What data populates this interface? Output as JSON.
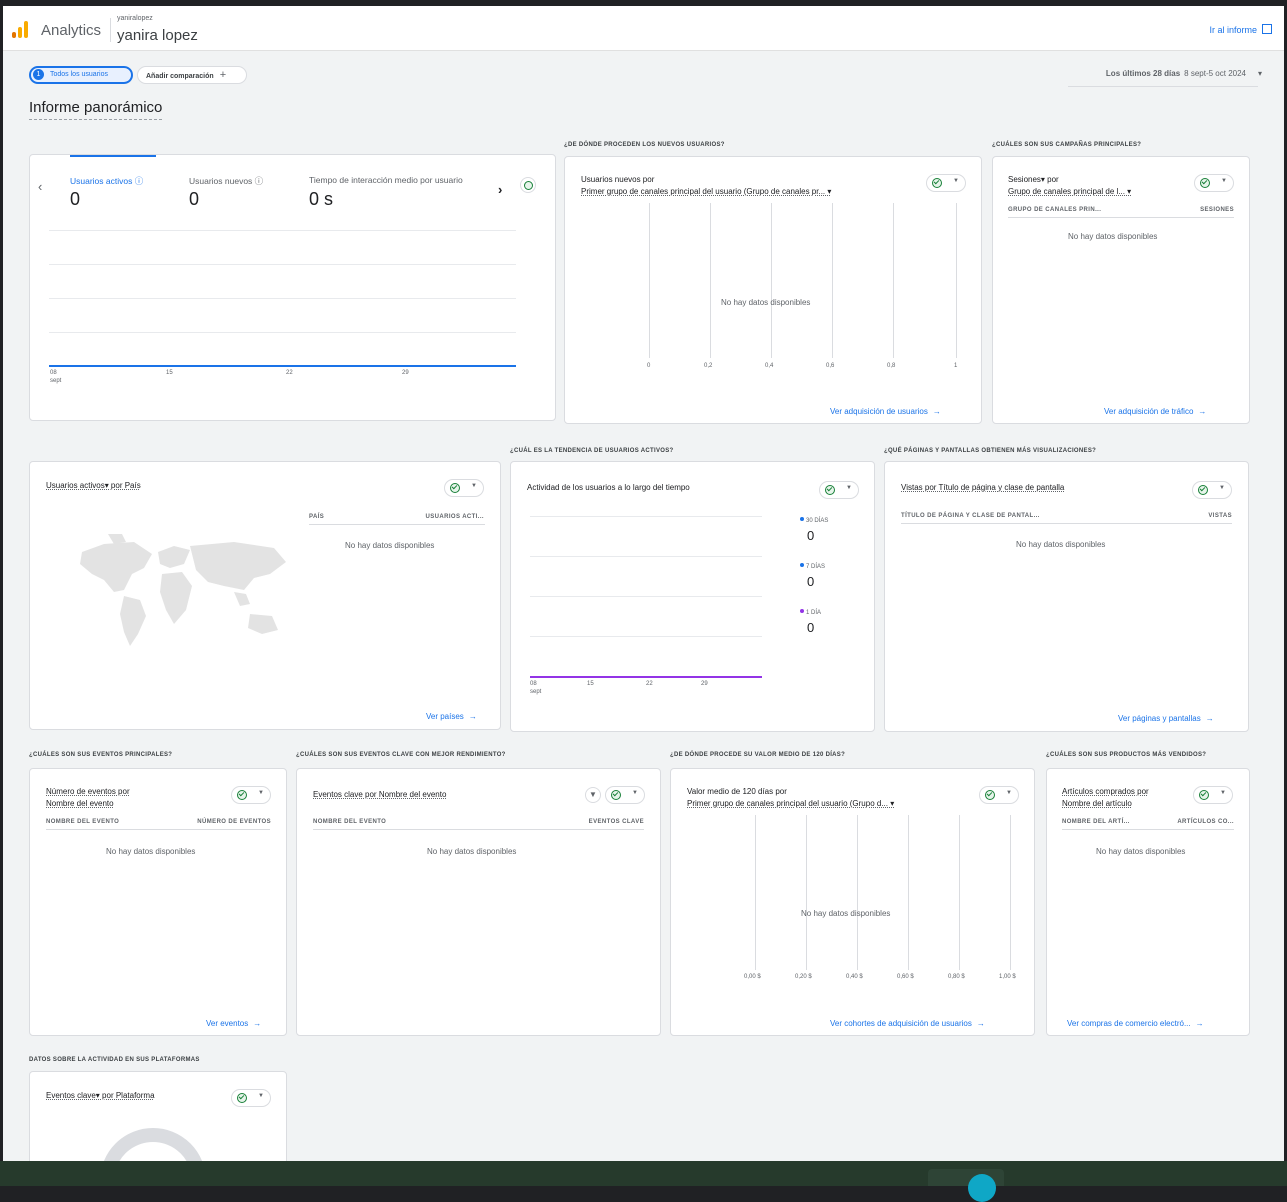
{
  "header": {
    "app_name": "Analytics",
    "account_small": "yaniralopez",
    "account_name": "yanira lopez",
    "report_link": "Ir al informe"
  },
  "toolbar": {
    "segment_number": "1",
    "segment_chip": "Todos los usuarios",
    "add_comparison": "Añadir comparación",
    "date_label": "Los últimos 28 días",
    "date_range": "8 sept-5 oct 2024"
  },
  "page_title": "Informe panorámico",
  "sections": {
    "new_users_source": "¿DE DÓNDE PROCEDEN LOS NUEVOS USUARIOS?",
    "campaigns": "¿CUÁLES SON SUS CAMPAÑAS PRINCIPALES?",
    "active_trend": "¿CUÁL ES LA TENDENCIA DE USUARIOS ACTIVOS?",
    "pages": "¿QUÉ PÁGINAS Y PANTALLAS OBTIENEN MÁS VISUALIZACIONES?",
    "top_events": "¿CUÁLES SON SUS EVENTOS PRINCIPALES?",
    "key_events": "¿CUÁLES SON SUS EVENTOS CLAVE CON MEJOR RENDIMIENTO?",
    "ltv": "¿DE DÓNDE PROCEDE SU VALOR MEDIO DE 120 DÍAS?",
    "products": "¿CUÁLES SON SUS PRODUCTOS MÁS VENDIDOS?",
    "platforms": "DATOS SOBRE LA ACTIVIDAD EN SUS PLATAFORMAS"
  },
  "no_data": "No hay datos disponibles",
  "overview": {
    "metrics": [
      {
        "label": "Usuarios activos",
        "value": "0"
      },
      {
        "label": "Usuarios nuevos",
        "value": "0"
      },
      {
        "label": "Tiempo de interacción medio por usuario",
        "value": "0 s"
      }
    ],
    "x_ticks": [
      "08",
      "15",
      "22",
      "29"
    ],
    "x_month": "sept"
  },
  "new_users_card": {
    "title_line1": "Usuarios nuevos por",
    "title_line2": "Primer grupo de canales principal del usuario (Grupo de canales pr... ▾",
    "x_ticks": [
      "0",
      "0,2",
      "0,4",
      "0,6",
      "0,8",
      "1"
    ],
    "link": "Ver adquisición de usuarios"
  },
  "campaigns_card": {
    "title_line1": "Sesiones▾ por",
    "title_line2": "Grupo de canales principal de l... ▾",
    "col1": "GRUPO DE CANALES PRIN...",
    "col2": "SESIONES",
    "link": "Ver adquisición de tráfico"
  },
  "country_card": {
    "title": "Usuarios activos▾ por País",
    "col1": "PAÍS",
    "col2": "USUARIOS ACTI...",
    "link": "Ver países"
  },
  "trend_card": {
    "title": "Actividad de los usuarios a lo largo del tiempo",
    "legend": [
      {
        "label": "30 DÍAS",
        "value": "0",
        "color": "#1a73e8"
      },
      {
        "label": "7 DÍAS",
        "value": "0",
        "color": "#1a73e8"
      },
      {
        "label": "1 DÍA",
        "value": "0",
        "color": "#9334e6"
      }
    ],
    "x_ticks": [
      "08",
      "15",
      "22",
      "29"
    ],
    "x_month": "sept"
  },
  "pages_card": {
    "title": "Vistas por Título de página y clase de pantalla",
    "col1": "TÍTULO DE PÁGINA Y CLASE DE PANTAL...",
    "col2": "VISTAS",
    "link": "Ver páginas y pantallas"
  },
  "events_card": {
    "title_line1": "Número de eventos por",
    "title_line2": "Nombre del evento",
    "col1": "NOMBRE DEL EVENTO",
    "col2": "NÚMERO DE EVENTOS",
    "link": "Ver eventos"
  },
  "key_events_card": {
    "title": "Eventos clave por Nombre del evento",
    "col1": "NOMBRE DEL EVENTO",
    "col2": "EVENTOS CLAVE"
  },
  "ltv_card": {
    "title_line1": "Valor medio de 120 días por",
    "title_line2": "Primer grupo de canales principal del usuario (Grupo d... ▾",
    "x_ticks": [
      "0,00 $",
      "0,20 $",
      "0,40 $",
      "0,60 $",
      "0,80 $",
      "1,00 $"
    ],
    "link": "Ver cohortes de adquisición de usuarios"
  },
  "products_card": {
    "title_line1": "Artículos comprados por",
    "title_line2": "Nombre del artículo",
    "col1": "NOMBRE DEL ARTÍ...",
    "col2": "ARTÍCULOS CO...",
    "link": "Ver compras de comercio electró..."
  },
  "platform_card": {
    "title": "Eventos clave▾ por Plataforma"
  },
  "colors": {
    "accent": "#1a73e8",
    "logo_orange": "#f9ab00",
    "logo_dark_orange": "#e37400",
    "compare_green": "#188038",
    "one_day_purple": "#9334e6"
  }
}
